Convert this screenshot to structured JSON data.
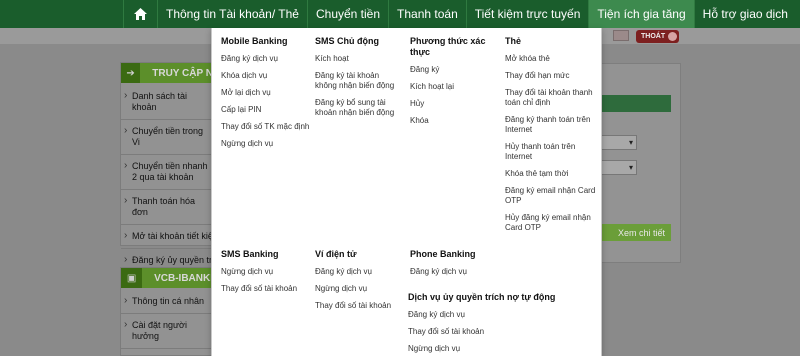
{
  "nav": {
    "items": [
      {
        "label": "Thông tin Tài khoản/ Thẻ"
      },
      {
        "label": "Chuyển tiền"
      },
      {
        "label": "Thanh toán"
      },
      {
        "label": "Tiết kiệm trực tuyến"
      },
      {
        "label": "Tiện ích gia tăng"
      },
      {
        "label": "Hỗ trợ giao dịch"
      }
    ],
    "active_index": 4
  },
  "header": {
    "logout_label": "THOÁT"
  },
  "left": {
    "card1_title": "TRUY CẬP N",
    "card1_items": [
      "Danh sách tài khoản",
      "Chuyển tiền trong Vi",
      "Chuyển tiền nhanh 2 qua tài khoản",
      "Thanh toán hóa đơn",
      "Mở tài khoản tiết kiệ",
      "Đăng ký ủy quyền tr VCB-Auto Debit"
    ],
    "card2_title": "VCB-IBANKI",
    "card2_items": [
      "Thông tin cá nhân",
      "Cài đặt người hưởng"
    ]
  },
  "right": {
    "view_detail": "Xem chi tiết"
  },
  "menu": {
    "mobile_banking": {
      "heading": "Mobile Banking",
      "items": [
        "Đăng ký dịch vụ",
        "Khóa dịch vụ",
        "Mở lại dịch vụ",
        "Cấp lại PIN",
        "Thay đổi số TK mặc định",
        "Ngừng dịch vụ"
      ]
    },
    "sms_chu_dong": {
      "heading": "SMS Chủ động",
      "items": [
        "Kích hoạt",
        "Đăng ký tài khoản không nhận biến động",
        "Đăng ký bổ sung tài khoản nhận biến động"
      ]
    },
    "phuong_thuc": {
      "heading": "Phương thức xác thực",
      "items": [
        "Đăng ký",
        "Kích hoạt lại",
        "Hủy",
        "Khóa"
      ]
    },
    "the": {
      "heading": "Thẻ",
      "items": [
        "Mở khóa thẻ",
        "Thay đổi hạn mức",
        "Thay đổi tài khoản thanh toán chỉ định",
        "Đăng ký thanh toán trên Internet",
        "Hủy thanh toán trên Internet",
        "Khóa thẻ tạm thời",
        "Đăng ký email nhận Card OTP",
        "Hủy đăng ký email nhận Card OTP"
      ]
    },
    "sms_banking": {
      "heading": "SMS Banking",
      "items": [
        "Ngừng dịch vụ",
        "Thay đổi số tài khoản"
      ]
    },
    "vi_dien_tu": {
      "heading": "Ví điện tử",
      "items": [
        "Đăng ký dịch vụ",
        "Ngừng dịch vụ",
        "Thay đổi số tài khoản"
      ]
    },
    "phone_banking": {
      "heading": "Phone Banking",
      "items": [
        "Đăng ký dịch vụ"
      ]
    },
    "uy_quyen": {
      "heading": "Dịch vụ ủy quyền trích nợ tự động",
      "items": [
        "Đăng ký dịch vụ",
        "Thay đổi số tài khoản",
        "Ngừng dịch vụ"
      ]
    }
  },
  "colors": {
    "nav_bg": "#1a5d2c",
    "nav_active": "#3d8a4e",
    "menu_bg": "#ffffff"
  }
}
